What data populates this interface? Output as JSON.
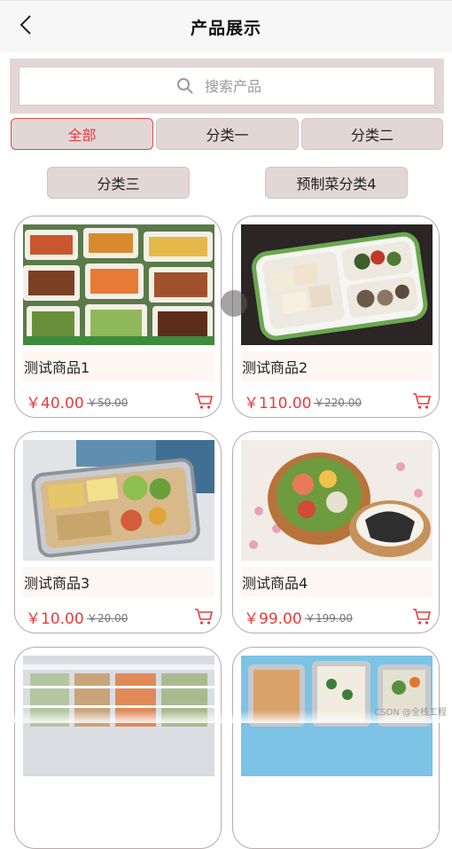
{
  "header": {
    "title": "产品展示",
    "back_icon": "chevron-left-icon"
  },
  "search": {
    "placeholder": "搜索产品",
    "icon": "search-icon"
  },
  "tabs": [
    {
      "label": "全部",
      "active": true
    },
    {
      "label": "分类一"
    },
    {
      "label": "分类二"
    },
    {
      "label": "分类三"
    },
    {
      "label": "预制菜分类4"
    }
  ],
  "colors": {
    "accent": "#e83b3b",
    "tab_bg": "#e3d7d6",
    "name_bar_bg": "#fdf6f2"
  },
  "products": [
    {
      "name": "测试商品1",
      "price": "￥40.00",
      "old_price": "￥50.00",
      "image": "bento-trays-photo",
      "cart_icon": "cart-icon"
    },
    {
      "name": "测试商品2",
      "price": "￥110.00",
      "old_price": "￥220.00",
      "image": "compartment-box-photo",
      "cart_icon": "cart-icon"
    },
    {
      "name": "测试商品3",
      "price": "￥10.00",
      "old_price": "￥20.00",
      "image": "steel-tray-photo",
      "cart_icon": "cart-icon"
    },
    {
      "name": "测试商品4",
      "price": "￥99.00",
      "old_price": "￥199.00",
      "image": "wooden-bento-photo",
      "cart_icon": "cart-icon"
    },
    {
      "name": "",
      "price": "",
      "old_price": "",
      "image": "fridge-shelf-photo"
    },
    {
      "name": "",
      "price": "",
      "old_price": "",
      "image": "foil-trays-photo"
    }
  ],
  "watermark": "CSDN @全栈工程"
}
